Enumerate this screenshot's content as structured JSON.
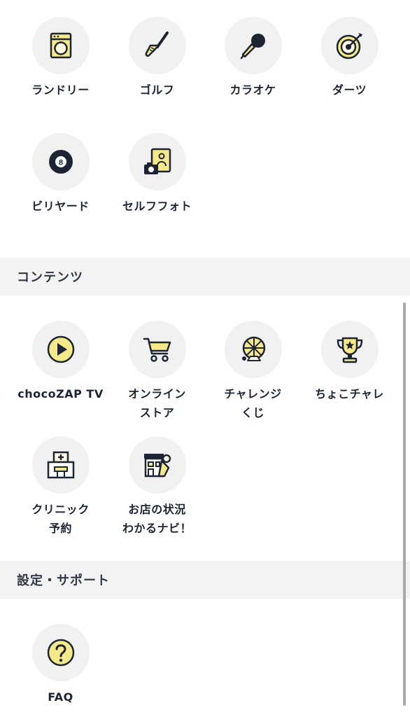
{
  "colors": {
    "accent": "#f6e98a",
    "ink": "#1d2535",
    "tile_bg": "#f1f1f1",
    "header_bg": "#f3f3f3"
  },
  "facilities": {
    "items": [
      {
        "label": "ランドリー",
        "icon": "washing-machine-icon"
      },
      {
        "label": "ゴルフ",
        "icon": "golf-club-icon"
      },
      {
        "label": "カラオケ",
        "icon": "microphone-icon"
      },
      {
        "label": "ダーツ",
        "icon": "dartboard-icon"
      },
      {
        "label": "ビリヤード",
        "icon": "billiard-ball-icon"
      },
      {
        "label": "セルフフォト",
        "icon": "camera-photo-icon"
      }
    ]
  },
  "contents": {
    "header": "コンテンツ",
    "items": [
      {
        "label": "chocoZAP TV",
        "icon": "play-icon"
      },
      {
        "label": "オンライン\nストア",
        "icon": "shopping-cart-icon"
      },
      {
        "label": "チャレンジ\nくじ",
        "icon": "lottery-wheel-icon"
      },
      {
        "label": "ちょこチャレ",
        "icon": "trophy-icon"
      },
      {
        "label": "クリニック\n予約",
        "icon": "clinic-icon"
      },
      {
        "label": "お店の状況\nわかるナビ！",
        "icon": "store-status-icon"
      }
    ]
  },
  "settings": {
    "header": "設定・サポート",
    "items": [
      {
        "label": "FAQ",
        "icon": "question-icon"
      }
    ]
  }
}
